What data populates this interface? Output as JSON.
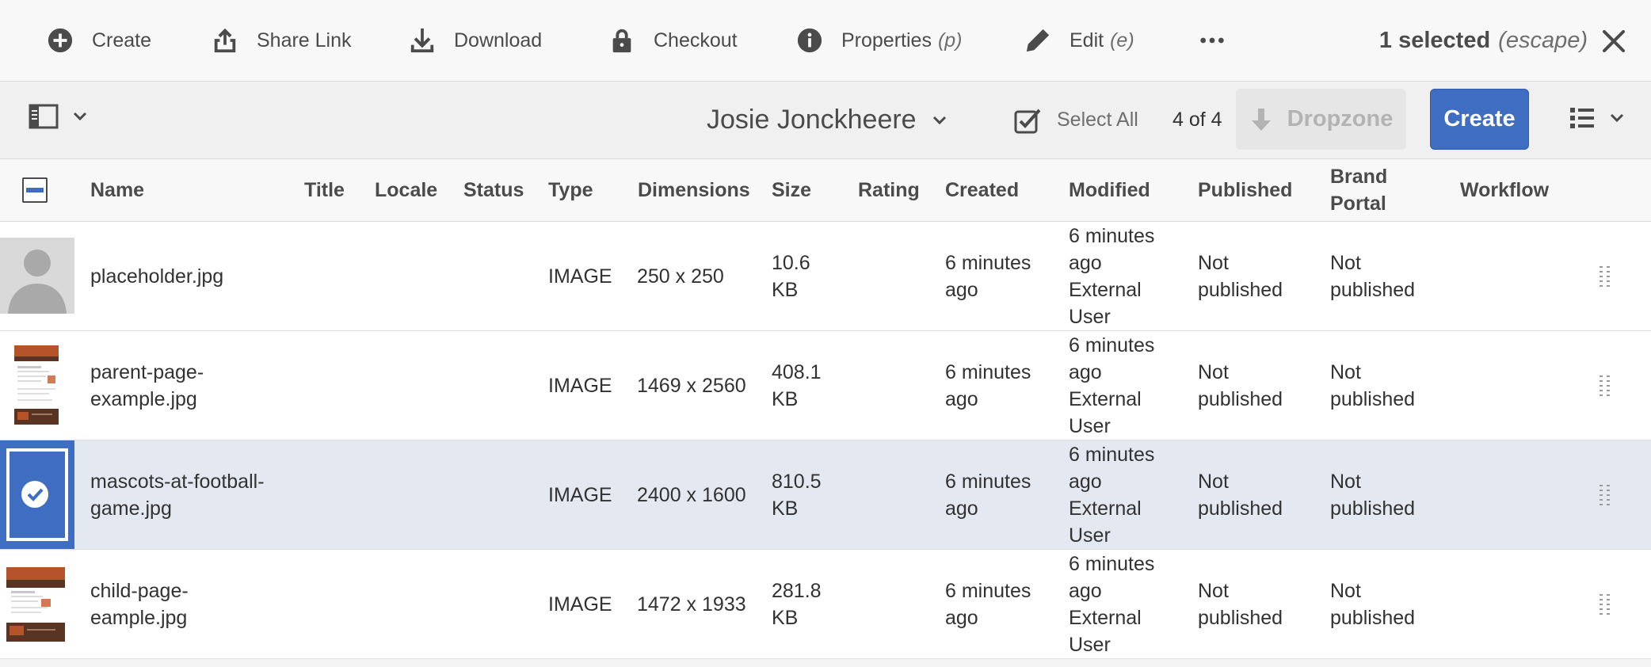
{
  "action_bar": {
    "create": "Create",
    "share_link": "Share Link",
    "download": "Download",
    "checkout": "Checkout",
    "properties": "Properties",
    "properties_hint": "(p)",
    "edit": "Edit",
    "edit_hint": "(e)",
    "selected_text": "1 selected",
    "selected_hint": "(escape)"
  },
  "header_bar": {
    "owner": "Josie Jonckheere",
    "select_all": "Select All",
    "count": "4 of 4",
    "dropzone": "Dropzone",
    "create": "Create"
  },
  "columns": {
    "name": "Name",
    "title": "Title",
    "locale": "Locale",
    "status": "Status",
    "type": "Type",
    "dimensions": "Dimensions",
    "size": "Size",
    "rating": "Rating",
    "created": "Created",
    "modified": "Modified",
    "published": "Published",
    "brand_portal_1": "Brand",
    "brand_portal_2": "Portal",
    "workflow": "Workflow"
  },
  "rows": [
    {
      "name_1": "placeholder.jpg",
      "name_2": "",
      "type": "IMAGE",
      "dimensions": "250 x 250",
      "size_1": "10.6",
      "size_2": "KB",
      "created_1": "6 minutes",
      "created_2": "ago",
      "modified_1": "6 minutes",
      "modified_2": "ago",
      "modified_3": "External",
      "modified_4": "User",
      "published_1": "Not",
      "published_2": "published",
      "brand_1": "Not",
      "brand_2": "published"
    },
    {
      "name_1": "parent-page-",
      "name_2": "example.jpg",
      "type": "IMAGE",
      "dimensions": "1469 x 2560",
      "size_1": "408.1",
      "size_2": "KB",
      "created_1": "6 minutes",
      "created_2": "ago",
      "modified_1": "6 minutes",
      "modified_2": "ago",
      "modified_3": "External",
      "modified_4": "User",
      "published_1": "Not",
      "published_2": "published",
      "brand_1": "Not",
      "brand_2": "published"
    },
    {
      "name_1": "mascots-at-football-",
      "name_2": "game.jpg",
      "type": "IMAGE",
      "dimensions": "2400 x 1600",
      "size_1": "810.5",
      "size_2": "KB",
      "created_1": "6 minutes",
      "created_2": "ago",
      "modified_1": "6 minutes",
      "modified_2": "ago",
      "modified_3": "External",
      "modified_4": "User",
      "published_1": "Not",
      "published_2": "published",
      "brand_1": "Not",
      "brand_2": "published"
    },
    {
      "name_1": "child-page-",
      "name_2": "eample.jpg",
      "type": "IMAGE",
      "dimensions": "1472 x 1933",
      "size_1": "281.8",
      "size_2": "KB",
      "created_1": "6 minutes",
      "created_2": "ago",
      "modified_1": "6 minutes",
      "modified_2": "ago",
      "modified_3": "External",
      "modified_4": "User",
      "published_1": "Not",
      "published_2": "published",
      "brand_1": "Not",
      "brand_2": "published"
    }
  ],
  "colors": {
    "accent": "#3f6dc2",
    "selected_row": "#e4e8f1",
    "disabled": "#e6e6e6"
  },
  "icons": {
    "create": "add-circle-icon",
    "share": "share-icon",
    "download": "download-icon",
    "checkout": "lock-icon",
    "properties": "info-icon",
    "edit": "pencil-icon",
    "more": "more-icon",
    "close": "close-icon"
  }
}
